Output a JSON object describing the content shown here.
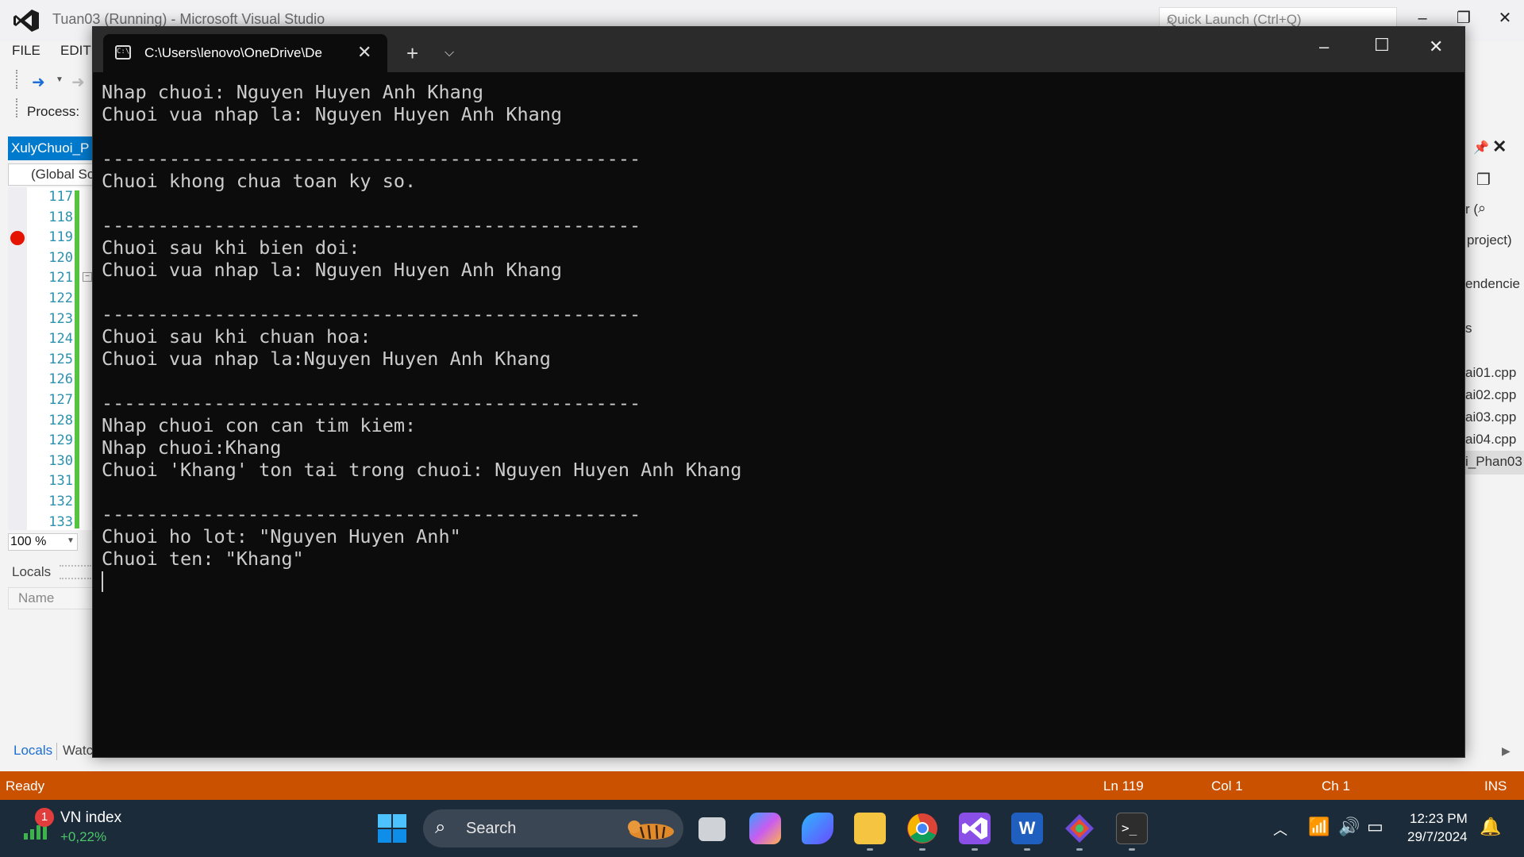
{
  "vs": {
    "title": "Tuan03 (Running) - Microsoft Visual Studio",
    "quick_launch_placeholder": "Quick Launch (Ctrl+Q)",
    "menu": [
      "FILE",
      "EDIT"
    ],
    "process_label": "Process:",
    "doc_tab": "XulyChuoi_P",
    "scope": "(Global Sc",
    "line_numbers": [
      "117",
      "118",
      "119",
      "120",
      "121",
      "122",
      "123",
      "124",
      "125",
      "126",
      "127",
      "128",
      "129",
      "130",
      "131",
      "132",
      "133"
    ],
    "breakpoint_line": "119",
    "zoom": "100 %",
    "locals_title": "Locals",
    "name_column": "Name",
    "bottom_tabs": [
      "Locals",
      "Watc"
    ],
    "right_panel": [
      "r (",
      "project)",
      "endencie",
      "s",
      "ai01.cpp",
      "ai02.cpp",
      "ai03.cpp",
      "ai04.cpp",
      "i_Phan03"
    ],
    "status": {
      "ready": "Ready",
      "ln": "Ln 119",
      "col": "Col 1",
      "ch": "Ch 1",
      "ins": "INS"
    },
    "colors": {
      "accent": "#007acc",
      "status_bar": "#ca5100",
      "breakpoint": "#e51400"
    }
  },
  "terminal": {
    "tab_title": "C:\\Users\\lenovo\\OneDrive\\De",
    "lines": [
      "Nhap chuoi: Nguyen Huyen Anh Khang",
      "Chuoi vua nhap la: Nguyen Huyen Anh Khang",
      "",
      "------------------------------------------------",
      "Chuoi khong chua toan ky so.",
      "",
      "------------------------------------------------",
      "Chuoi sau khi bien doi:",
      "Chuoi vua nhap la: Nguyen Huyen Anh Khang",
      "",
      "------------------------------------------------",
      "Chuoi sau khi chuan hoa:",
      "Chuoi vua nhap la:Nguyen Huyen Anh Khang",
      "",
      "------------------------------------------------",
      "Nhap chuoi con can tim kiem:",
      "Nhap chuoi:Khang",
      "Chuoi 'Khang' ton tai trong chuoi: Nguyen Huyen Anh Khang",
      "",
      "------------------------------------------------",
      "Chuoi ho lot: \"Nguyen Huyen Anh\"",
      "Chuoi ten: \"Khang\""
    ]
  },
  "taskbar": {
    "widget_badge": "1",
    "widget_title": "VN index",
    "widget_change": "+0,22%",
    "search_label": "Search",
    "time": "12:23 PM",
    "date": "29/7/2024",
    "apps": [
      "task-view-icon",
      "copilot-icon",
      "bing-icon",
      "file-explorer-icon",
      "chrome-icon",
      "visual-studio-icon",
      "word-icon",
      "git-icon",
      "terminal-icon"
    ]
  }
}
